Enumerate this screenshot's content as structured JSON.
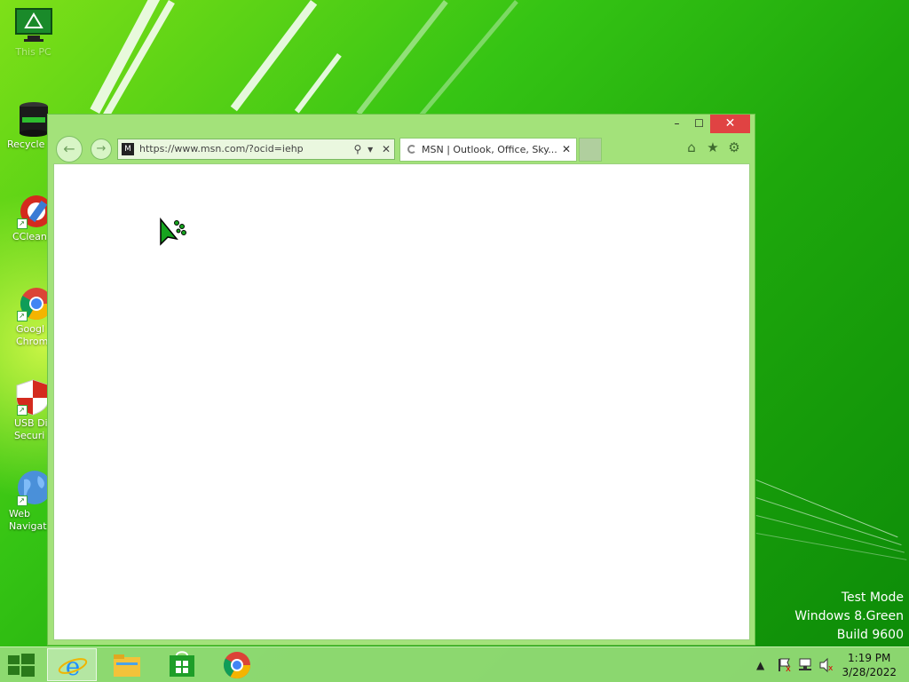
{
  "desktop": {
    "icons": [
      {
        "label": "This PC",
        "icon": "monitor-icon"
      },
      {
        "label": "Recycle",
        "icon": "recycle-bin-icon"
      },
      {
        "label": "CClean",
        "icon": "ccleaner-icon"
      },
      {
        "label": "Googl\nChrom",
        "icon": "chrome-icon"
      },
      {
        "label": "USB Di\nSecuri",
        "icon": "usb-security-shield-icon"
      },
      {
        "label": "Web\nNavigat",
        "icon": "globe-icon"
      }
    ],
    "watermark": {
      "line1": "Test Mode",
      "line2": "Windows 8.Green",
      "line3": "Build 9600"
    }
  },
  "browser": {
    "window_controls": {
      "minimize": "–",
      "maximize": "☐",
      "close": "✕"
    },
    "address": {
      "url": "https://www.msn.com/?ocid=iehp",
      "search_glyph": "⚲",
      "dropdown_glyph": "▾",
      "stop_glyph": "✕"
    },
    "tab": {
      "title": "MSN | Outlook, Office, Sky...",
      "close_glyph": "✕"
    },
    "toolbar": {
      "home": "⌂",
      "favorites": "★",
      "settings": "⚙"
    },
    "nav": {
      "back": "←",
      "forward": "→"
    }
  },
  "taskbar": {
    "apps": [
      "start-windows-icon",
      "internet-explorer-icon",
      "file-explorer-icon",
      "store-icon",
      "chrome-icon"
    ],
    "tray": {
      "chevron": "▲"
    },
    "clock": {
      "time": "1:19 PM",
      "date": "3/28/2022"
    }
  },
  "colors": {
    "accent": "#37c414",
    "close": "#e04343",
    "window_frame": "#a3e27a"
  }
}
